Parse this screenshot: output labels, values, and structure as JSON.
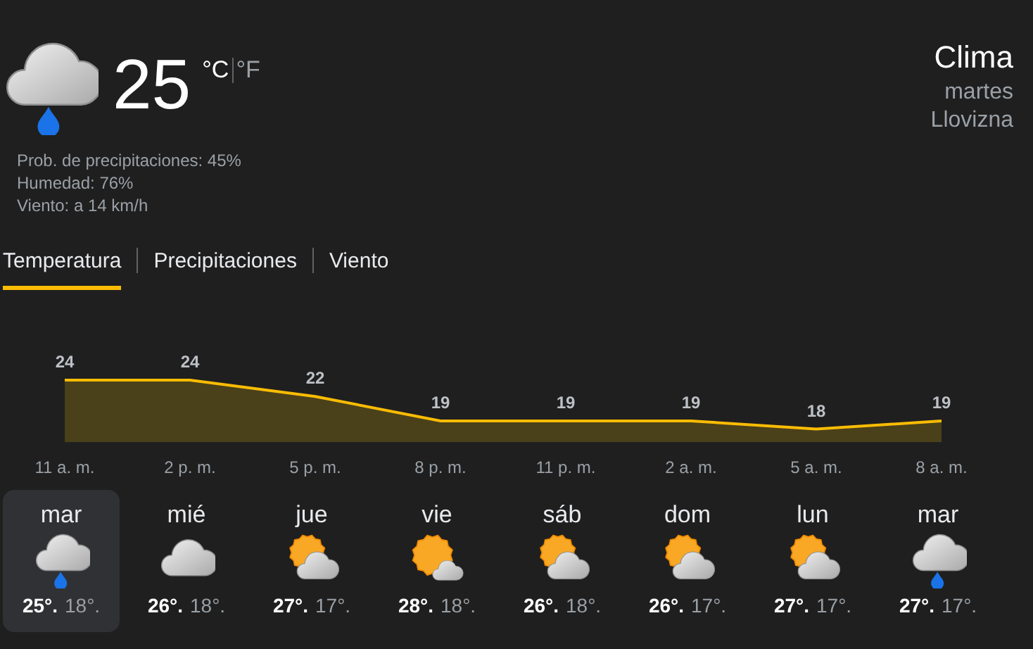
{
  "current": {
    "kind": "rain",
    "temperature": "25",
    "units": [
      {
        "label": "°C",
        "selected": true
      },
      {
        "label": "°F",
        "selected": false
      }
    ],
    "details": [
      "Prob. de precipitaciones: 45%",
      "Humedad: 76%",
      "Viento: a 14 km/h"
    ]
  },
  "header": {
    "title": "Clima",
    "day": "martes",
    "condition": "Llovizna"
  },
  "tabs": [
    {
      "label": "Temperatura",
      "selected": true
    },
    {
      "label": "Precipitaciones",
      "selected": false
    },
    {
      "label": "Viento",
      "selected": false
    }
  ],
  "chart_data": {
    "type": "area",
    "categories": [
      "11 a. m.",
      "2 p. m.",
      "5 p. m.",
      "8 p. m.",
      "11 p. m.",
      "2 a. m.",
      "5 a. m.",
      "8 a. m."
    ],
    "series": [
      {
        "color": "#fbbc04",
        "values": [
          24,
          24,
          22,
          19,
          19,
          19,
          18,
          19
        ]
      }
    ],
    "data_labels": true
  },
  "days": [
    {
      "name": "mar",
      "kind": "rain",
      "high": "25°.",
      "low": "18°.",
      "selected": true
    },
    {
      "name": "mié",
      "kind": "cloudy",
      "high": "26°.",
      "low": "18°.",
      "selected": false
    },
    {
      "name": "jue",
      "kind": "partly_sunny",
      "high": "27°.",
      "low": "17°.",
      "selected": false
    },
    {
      "name": "vie",
      "kind": "mostly_sunny",
      "high": "28°.",
      "low": "18°.",
      "selected": false
    },
    {
      "name": "sáb",
      "kind": "partly_sunny",
      "high": "26°.",
      "low": "18°.",
      "selected": false
    },
    {
      "name": "dom",
      "kind": "partly_sunny",
      "high": "26°.",
      "low": "17°.",
      "selected": false
    },
    {
      "name": "lun",
      "kind": "partly_sunny",
      "high": "27°.",
      "low": "17°.",
      "selected": false
    },
    {
      "name": "mar",
      "kind": "rain",
      "high": "27°.",
      "low": "17°.",
      "selected": false
    }
  ]
}
